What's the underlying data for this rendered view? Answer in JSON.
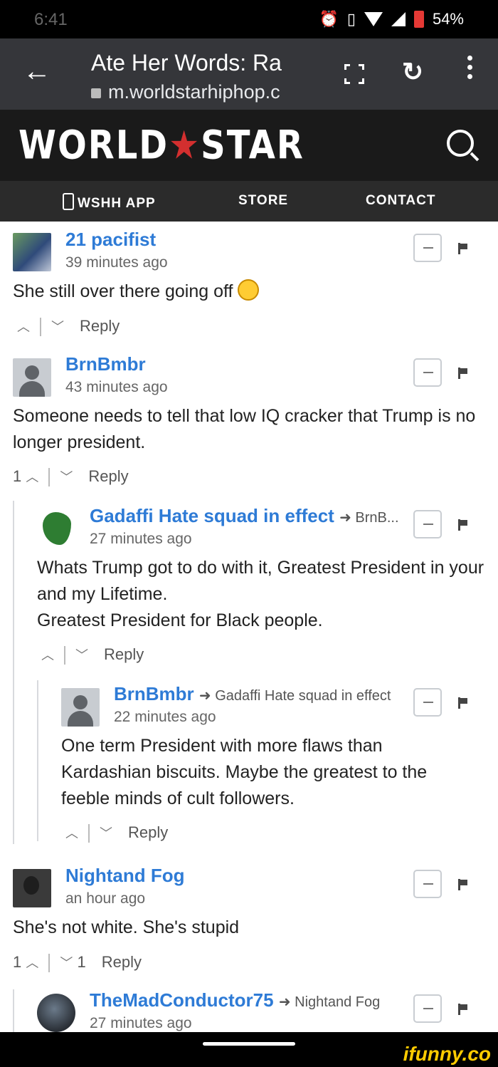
{
  "status": {
    "time": "6:41",
    "battery": "54%"
  },
  "browser": {
    "page_title": "Ate Her Words: Ra",
    "url": "m.worldstarhiphop.c"
  },
  "site": {
    "logo_left": "WORLD",
    "logo_star": "★",
    "logo_right": "STAR",
    "nav": {
      "app": "WSHH APP",
      "store": "STORE",
      "contact": "CONTACT"
    }
  },
  "comments": [
    {
      "author": "21 pacifist",
      "time": "39 minutes ago",
      "text": "She still over there going off",
      "votes": "",
      "downvotes": "",
      "reply": "Reply"
    },
    {
      "author": "BrnBmbr",
      "time": "43 minutes ago",
      "text": "Someone needs to tell that low IQ cracker that Trump is no longer president.",
      "votes": "1",
      "downvotes": "",
      "reply": "Reply"
    },
    {
      "author": "Gadaffi Hate squad in effect",
      "reply_to": "BrnB...",
      "time": "27 minutes ago",
      "text": "Whats Trump got to do with it, Greatest President in your and my Lifetime.\nGreatest President for Black people.",
      "reply": "Reply"
    },
    {
      "author": "BrnBmbr",
      "reply_to": "Gadaffi Hate squad in effect",
      "time": "22 minutes ago",
      "text": "One term President with more flaws than Kardashian biscuits. Maybe the greatest to the feeble minds of cult followers.",
      "reply": "Reply"
    },
    {
      "author": "Nightand Fog",
      "time": "an hour ago",
      "text": "She's not white. She's stupid",
      "votes": "1",
      "downvotes": "1",
      "reply": "Reply"
    },
    {
      "author": "TheMadConductor75",
      "reply_to": "Nightand Fog",
      "time": "27 minutes ago"
    }
  ],
  "watermark": "ifunny.co"
}
